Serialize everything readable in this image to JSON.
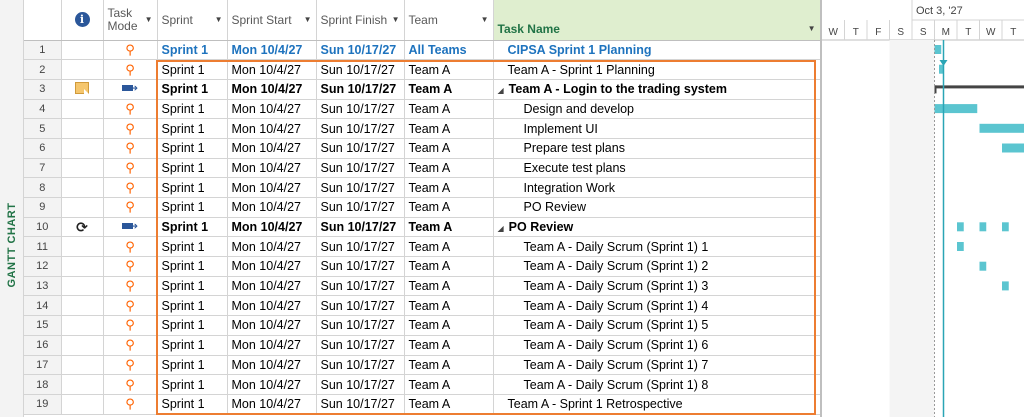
{
  "side_label": "GANTT CHART",
  "headers": {
    "num": "",
    "indicator_icon": "info-icon",
    "task_mode_line1": "Task",
    "task_mode_line2": "Mode",
    "sprint": "Sprint",
    "sprint_start": "Sprint Start",
    "sprint_finish": "Sprint Finish",
    "team": "Team",
    "task_name": "Task Name"
  },
  "timescale": {
    "week_label": "Oct 3, '27",
    "days": [
      "W",
      "T",
      "F",
      "S",
      "S",
      "M",
      "T",
      "W",
      "T"
    ]
  },
  "rows": [
    {
      "id": "1",
      "mode": "pin",
      "indicator": "",
      "sprint": "Sprint 1",
      "start": "Mon 10/4/27",
      "finish": "Sun 10/17/27",
      "team": "All Teams",
      "name": "CIPSA Sprint 1 Planning",
      "style": "summary-top",
      "indent": 0,
      "collapse": ""
    },
    {
      "id": "2",
      "mode": "pin",
      "indicator": "",
      "sprint": "Sprint 1",
      "start": "Mon 10/4/27",
      "finish": "Sun 10/17/27",
      "team": "Team A",
      "name": "Team A - Sprint 1 Planning",
      "style": "",
      "indent": 0,
      "collapse": ""
    },
    {
      "id": "3",
      "mode": "auto",
      "indicator": "note",
      "sprint": "Sprint 1",
      "start": "Mon 10/4/27",
      "finish": "Sun 10/17/27",
      "team": "Team A",
      "name": "Team A - Login to the trading system",
      "style": "bold",
      "indent": 0,
      "collapse": "◢"
    },
    {
      "id": "4",
      "mode": "pin",
      "indicator": "",
      "sprint": "Sprint 1",
      "start": "Mon 10/4/27",
      "finish": "Sun 10/17/27",
      "team": "Team A",
      "name": "Design and develop",
      "style": "",
      "indent": 1,
      "collapse": ""
    },
    {
      "id": "5",
      "mode": "pin",
      "indicator": "",
      "sprint": "Sprint 1",
      "start": "Mon 10/4/27",
      "finish": "Sun 10/17/27",
      "team": "Team A",
      "name": "Implement UI",
      "style": "",
      "indent": 1,
      "collapse": ""
    },
    {
      "id": "6",
      "mode": "pin",
      "indicator": "",
      "sprint": "Sprint 1",
      "start": "Mon 10/4/27",
      "finish": "Sun 10/17/27",
      "team": "Team A",
      "name": "Prepare test plans",
      "style": "",
      "indent": 1,
      "collapse": ""
    },
    {
      "id": "7",
      "mode": "pin",
      "indicator": "",
      "sprint": "Sprint 1",
      "start": "Mon 10/4/27",
      "finish": "Sun 10/17/27",
      "team": "Team A",
      "name": "Execute test plans",
      "style": "",
      "indent": 1,
      "collapse": ""
    },
    {
      "id": "8",
      "mode": "pin",
      "indicator": "",
      "sprint": "Sprint 1",
      "start": "Mon 10/4/27",
      "finish": "Sun 10/17/27",
      "team": "Team A",
      "name": "Integration Work",
      "style": "",
      "indent": 1,
      "collapse": ""
    },
    {
      "id": "9",
      "mode": "pin",
      "indicator": "",
      "sprint": "Sprint 1",
      "start": "Mon 10/4/27",
      "finish": "Sun 10/17/27",
      "team": "Team A",
      "name": "PO Review",
      "style": "",
      "indent": 1,
      "collapse": ""
    },
    {
      "id": "10",
      "mode": "auto",
      "indicator": "recurring",
      "sprint": "Sprint 1",
      "start": "Mon 10/4/27",
      "finish": "Sun 10/17/27",
      "team": "Team A",
      "name": "PO Review",
      "style": "bold",
      "indent": 0,
      "collapse": "◢"
    },
    {
      "id": "11",
      "mode": "pin",
      "indicator": "",
      "sprint": "Sprint 1",
      "start": "Mon 10/4/27",
      "finish": "Sun 10/17/27",
      "team": "Team A",
      "name": "Team A - Daily Scrum (Sprint 1) 1",
      "style": "",
      "indent": 1,
      "collapse": ""
    },
    {
      "id": "12",
      "mode": "pin",
      "indicator": "",
      "sprint": "Sprint 1",
      "start": "Mon 10/4/27",
      "finish": "Sun 10/17/27",
      "team": "Team A",
      "name": "Team A - Daily Scrum (Sprint 1) 2",
      "style": "",
      "indent": 1,
      "collapse": ""
    },
    {
      "id": "13",
      "mode": "pin",
      "indicator": "",
      "sprint": "Sprint 1",
      "start": "Mon 10/4/27",
      "finish": "Sun 10/17/27",
      "team": "Team A",
      "name": "Team A - Daily Scrum (Sprint 1) 3",
      "style": "",
      "indent": 1,
      "collapse": ""
    },
    {
      "id": "14",
      "mode": "pin",
      "indicator": "",
      "sprint": "Sprint 1",
      "start": "Mon 10/4/27",
      "finish": "Sun 10/17/27",
      "team": "Team A",
      "name": "Team A - Daily Scrum (Sprint 1) 4",
      "style": "",
      "indent": 1,
      "collapse": ""
    },
    {
      "id": "15",
      "mode": "pin",
      "indicator": "",
      "sprint": "Sprint 1",
      "start": "Mon 10/4/27",
      "finish": "Sun 10/17/27",
      "team": "Team A",
      "name": "Team A - Daily Scrum (Sprint 1) 5",
      "style": "",
      "indent": 1,
      "collapse": ""
    },
    {
      "id": "16",
      "mode": "pin",
      "indicator": "",
      "sprint": "Sprint 1",
      "start": "Mon 10/4/27",
      "finish": "Sun 10/17/27",
      "team": "Team A",
      "name": "Team A - Daily Scrum (Sprint 1) 6",
      "style": "",
      "indent": 1,
      "collapse": ""
    },
    {
      "id": "17",
      "mode": "pin",
      "indicator": "",
      "sprint": "Sprint 1",
      "start": "Mon 10/4/27",
      "finish": "Sun 10/17/27",
      "team": "Team A",
      "name": "Team A - Daily Scrum (Sprint 1) 7",
      "style": "",
      "indent": 1,
      "collapse": ""
    },
    {
      "id": "18",
      "mode": "pin",
      "indicator": "",
      "sprint": "Sprint 1",
      "start": "Mon 10/4/27",
      "finish": "Sun 10/17/27",
      "team": "Team A",
      "name": "Team A - Daily Scrum (Sprint 1) 8",
      "style": "",
      "indent": 1,
      "collapse": ""
    },
    {
      "id": "19",
      "mode": "pin",
      "indicator": "",
      "sprint": "Sprint 1",
      "start": "Mon 10/4/27",
      "finish": "Sun 10/17/27",
      "team": "Team A",
      "name": "Team A - Sprint 1 Retrospective",
      "style": "",
      "indent": 0,
      "collapse": ""
    }
  ],
  "colors": {
    "accent_green": "#217346",
    "task_name_header_bg": "#dfeecf",
    "summary_blue": "#1e73be",
    "highlight_box": "#ed7d31",
    "gantt_bar": "#5bc5d0",
    "today_line": "#2aa5b5"
  },
  "gantt_bars": [
    {
      "row": 1,
      "start_day": 5.0,
      "end_day": 5.3,
      "kind": "task"
    },
    {
      "row": 2,
      "start_day": 5.2,
      "end_day": 5.4,
      "kind": "task"
    },
    {
      "row": 3,
      "start_day": 5.0,
      "end_day": 9.0,
      "kind": "summary"
    },
    {
      "row": 4,
      "start_day": 5.0,
      "end_day": 6.9,
      "kind": "task"
    },
    {
      "row": 5,
      "start_day": 7.0,
      "end_day": 9.0,
      "kind": "task"
    },
    {
      "row": 6,
      "start_day": 8.0,
      "end_day": 9.0,
      "kind": "task"
    },
    {
      "row": 10,
      "start_day": 6.0,
      "end_day": 6.3,
      "kind": "task"
    },
    {
      "row": 10,
      "start_day": 7.0,
      "end_day": 7.3,
      "kind": "task"
    },
    {
      "row": 10,
      "start_day": 8.0,
      "end_day": 8.3,
      "kind": "task"
    },
    {
      "row": 11,
      "start_day": 6.0,
      "end_day": 6.3,
      "kind": "task"
    },
    {
      "row": 12,
      "start_day": 7.0,
      "end_day": 7.3,
      "kind": "task"
    },
    {
      "row": 13,
      "start_day": 8.0,
      "end_day": 8.3,
      "kind": "task"
    }
  ]
}
